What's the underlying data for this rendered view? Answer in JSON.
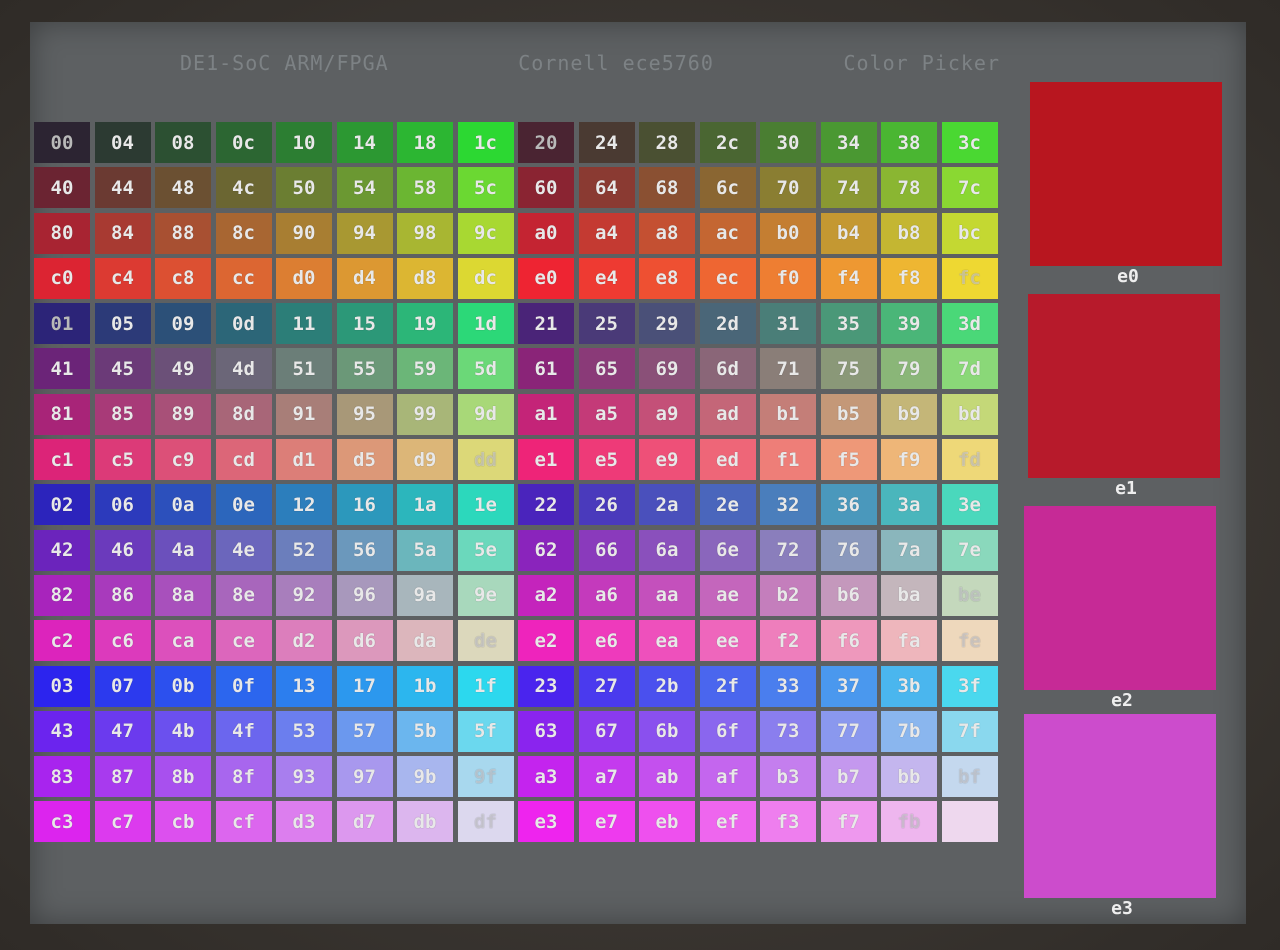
{
  "header": {
    "title_left": "DE1-SoC ARM/FPGA",
    "title_center": "Cornell ece5760",
    "title_right": "Color Picker"
  },
  "palette": {
    "rows": [
      [
        "00",
        "04",
        "08",
        "0c",
        "10",
        "14",
        "18",
        "1c",
        "20",
        "24",
        "28",
        "2c",
        "30",
        "34",
        "38",
        "3c"
      ],
      [
        "40",
        "44",
        "48",
        "4c",
        "50",
        "54",
        "58",
        "5c",
        "60",
        "64",
        "68",
        "6c",
        "70",
        "74",
        "78",
        "7c"
      ],
      [
        "80",
        "84",
        "88",
        "8c",
        "90",
        "94",
        "98",
        "9c",
        "a0",
        "a4",
        "a8",
        "ac",
        "b0",
        "b4",
        "b8",
        "bc"
      ],
      [
        "c0",
        "c4",
        "c8",
        "cc",
        "d0",
        "d4",
        "d8",
        "dc",
        "e0",
        "e4",
        "e8",
        "ec",
        "f0",
        "f4",
        "f8",
        "fc"
      ],
      [
        "01",
        "05",
        "09",
        "0d",
        "11",
        "15",
        "19",
        "1d",
        "21",
        "25",
        "29",
        "2d",
        "31",
        "35",
        "39",
        "3d"
      ],
      [
        "41",
        "45",
        "49",
        "4d",
        "51",
        "55",
        "59",
        "5d",
        "61",
        "65",
        "69",
        "6d",
        "71",
        "75",
        "79",
        "7d"
      ],
      [
        "81",
        "85",
        "89",
        "8d",
        "91",
        "95",
        "99",
        "9d",
        "a1",
        "a5",
        "a9",
        "ad",
        "b1",
        "b5",
        "b9",
        "bd"
      ],
      [
        "c1",
        "c5",
        "c9",
        "cd",
        "d1",
        "d5",
        "d9",
        "dd",
        "e1",
        "e5",
        "e9",
        "ed",
        "f1",
        "f5",
        "f9",
        "fd"
      ],
      [
        "02",
        "06",
        "0a",
        "0e",
        "12",
        "16",
        "1a",
        "1e",
        "22",
        "26",
        "2a",
        "2e",
        "32",
        "36",
        "3a",
        "3e"
      ],
      [
        "42",
        "46",
        "4a",
        "4e",
        "52",
        "56",
        "5a",
        "5e",
        "62",
        "66",
        "6a",
        "6e",
        "72",
        "76",
        "7a",
        "7e"
      ],
      [
        "82",
        "86",
        "8a",
        "8e",
        "92",
        "96",
        "9a",
        "9e",
        "a2",
        "a6",
        "aa",
        "ae",
        "b2",
        "b6",
        "ba",
        "be"
      ],
      [
        "c2",
        "c6",
        "ca",
        "ce",
        "d2",
        "d6",
        "da",
        "de",
        "e2",
        "e6",
        "ea",
        "ee",
        "f2",
        "f6",
        "fa",
        "fe"
      ],
      [
        "03",
        "07",
        "0b",
        "0f",
        "13",
        "17",
        "1b",
        "1f",
        "23",
        "27",
        "2b",
        "2f",
        "33",
        "37",
        "3b",
        "3f"
      ],
      [
        "43",
        "47",
        "4b",
        "4f",
        "53",
        "57",
        "5b",
        "5f",
        "63",
        "67",
        "6b",
        "6f",
        "73",
        "77",
        "7b",
        "7f"
      ],
      [
        "83",
        "87",
        "8b",
        "8f",
        "93",
        "97",
        "9b",
        "9f",
        "a3",
        "a7",
        "ab",
        "af",
        "b3",
        "b7",
        "bb",
        "bf"
      ],
      [
        "c3",
        "c7",
        "cb",
        "cf",
        "d3",
        "d7",
        "db",
        "df",
        "e3",
        "e7",
        "eb",
        "ef",
        "f3",
        "f7",
        "fb",
        ""
      ]
    ]
  },
  "swatches": [
    {
      "label": "e0",
      "color": "#b8161f"
    },
    {
      "label": "e1",
      "color": "#b71a2b"
    },
    {
      "label": "e2",
      "color": "#c62a96"
    },
    {
      "label": "e3",
      "color": "#cc4ccc"
    }
  ]
}
